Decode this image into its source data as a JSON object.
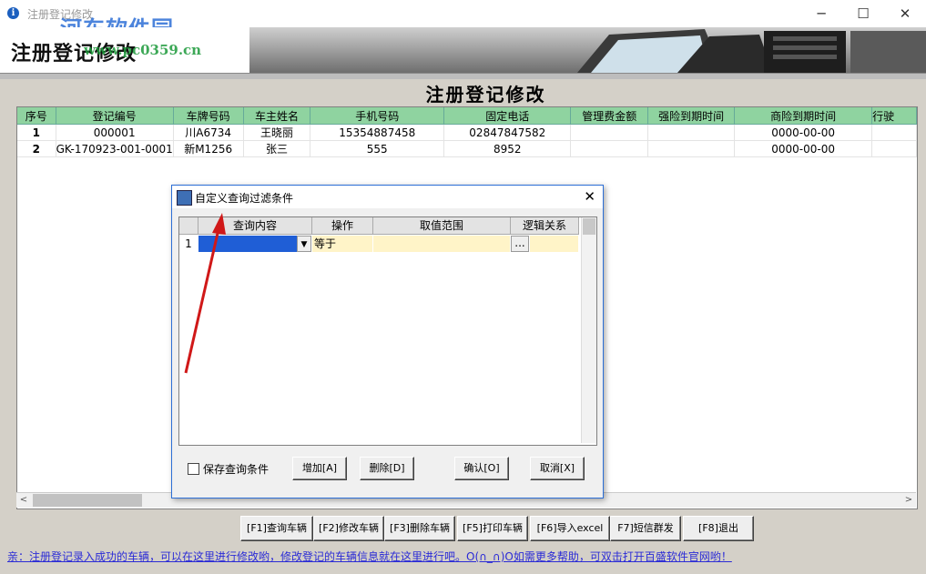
{
  "window": {
    "title": "注册登记修改",
    "watermark": "河东软件园",
    "watermark_url": "www.pc0359.cn",
    "banner_title": "注册登记修改",
    "heading": "注册登记修改",
    "controls": {
      "minimize": "─",
      "maximize": "☐",
      "close": "✕"
    }
  },
  "table": {
    "columns": [
      "序号",
      "登记编号",
      "车牌号码",
      "车主姓名",
      "手机号码",
      "固定电话",
      "管理费金额",
      "强险到期时间",
      "商险到期时间",
      "行驶"
    ],
    "rows": [
      [
        "1",
        "000001",
        "川A6734",
        "王晓丽",
        "15354887458",
        "02847847582",
        "",
        "",
        "0000-00-00",
        ""
      ],
      [
        "2",
        "GK-170923-001-0001",
        "新M1256",
        "张三",
        "555",
        "8952",
        "",
        "",
        "0000-00-00",
        ""
      ]
    ]
  },
  "scroll": {
    "left": "<",
    "right": ">"
  },
  "buttons": [
    "[F1]查询车辆",
    "[F2]修改车辆",
    "[F3]删除车辆",
    "[F5]打印车辆",
    "[F6]导入excel",
    "F7]短信群发",
    "[F8]退出"
  ],
  "status": "亲：注册登记录入成功的车辆，可以在这里进行修改哟，修改登记的车辆信息就在这里进行吧。O(∩_∩)O如需更多帮助，可双击打开百盛软件官网哟！",
  "dialog": {
    "title": "自定义查询过滤条件",
    "close": "✕",
    "columns": [
      "查询内容",
      "操作",
      "取值范围",
      "逻辑关系"
    ],
    "row": {
      "index": "1",
      "query": "",
      "op": "等于",
      "range": "",
      "range_btn": "...",
      "logic": ""
    },
    "dropdown": "▼",
    "save_label": "保存查询条件",
    "add": "增加[A]",
    "delete": "删除[D]",
    "ok": "确认[O]",
    "cancel": "取消[X]"
  }
}
